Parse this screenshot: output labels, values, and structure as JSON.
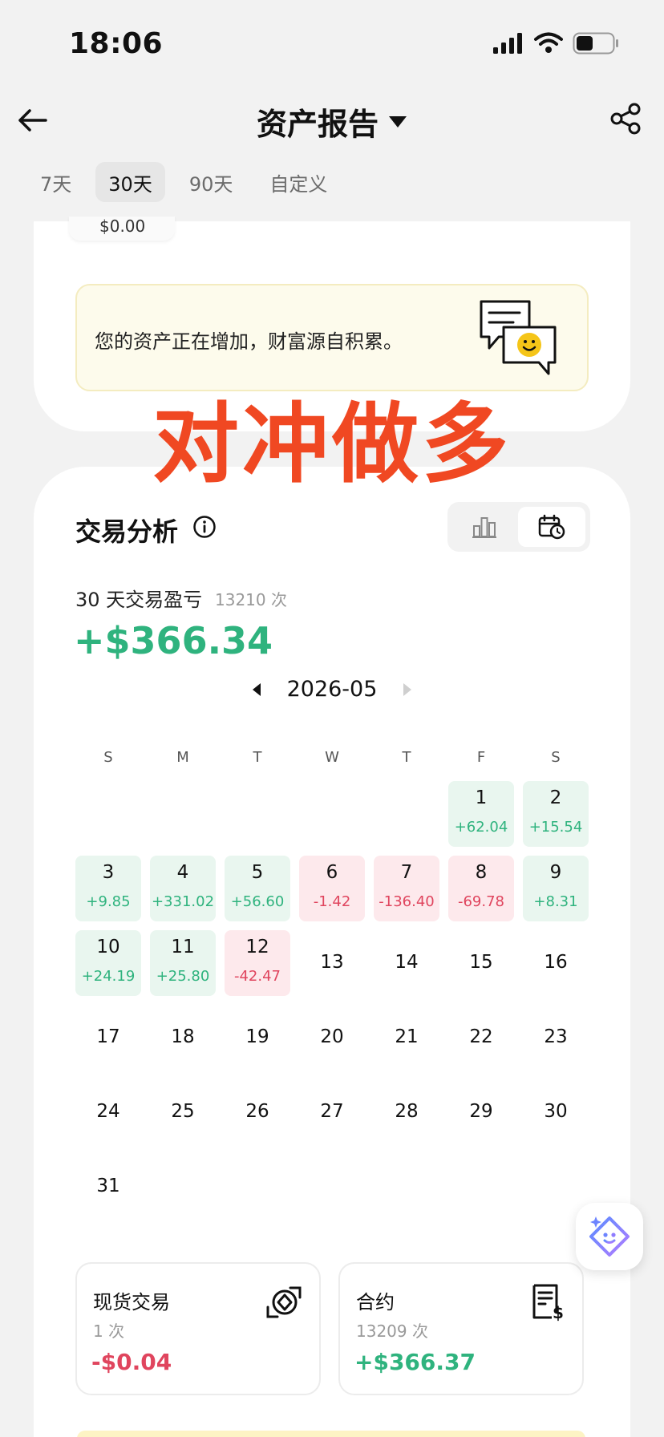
{
  "status_bar": {
    "time": "18:06"
  },
  "header": {
    "title": "资产报告"
  },
  "period_tabs": [
    {
      "label": "7天",
      "active": false
    },
    {
      "label": "30天",
      "active": true
    },
    {
      "label": "90天",
      "active": false
    },
    {
      "label": "自定义",
      "active": false
    }
  ],
  "assets": {
    "prev_value": "$0.00",
    "banner_text": "您的资产正在增加，财富源自积累。"
  },
  "overlay_text": "对冲做多",
  "analysis": {
    "title": "交易分析",
    "pnl_label": "30 天交易盈亏",
    "pnl_count": "13210 次",
    "pnl_value": "+$366.34",
    "month": "2026-05",
    "weekdays": [
      "S",
      "M",
      "T",
      "W",
      "T",
      "F",
      "S"
    ],
    "days": [
      {
        "num": "",
        "pnl": "",
        "tone": ""
      },
      {
        "num": "",
        "pnl": "",
        "tone": ""
      },
      {
        "num": "",
        "pnl": "",
        "tone": ""
      },
      {
        "num": "",
        "pnl": "",
        "tone": ""
      },
      {
        "num": "",
        "pnl": "",
        "tone": ""
      },
      {
        "num": "1",
        "pnl": "+62.04",
        "tone": "pos"
      },
      {
        "num": "2",
        "pnl": "+15.54",
        "tone": "pos"
      },
      {
        "num": "3",
        "pnl": "+9.85",
        "tone": "pos"
      },
      {
        "num": "4",
        "pnl": "+331.02",
        "tone": "pos"
      },
      {
        "num": "5",
        "pnl": "+56.60",
        "tone": "pos"
      },
      {
        "num": "6",
        "pnl": "-1.42",
        "tone": "neg"
      },
      {
        "num": "7",
        "pnl": "-136.40",
        "tone": "neg"
      },
      {
        "num": "8",
        "pnl": "-69.78",
        "tone": "neg"
      },
      {
        "num": "9",
        "pnl": "+8.31",
        "tone": "pos"
      },
      {
        "num": "10",
        "pnl": "+24.19",
        "tone": "pos"
      },
      {
        "num": "11",
        "pnl": "+25.80",
        "tone": "pos"
      },
      {
        "num": "12",
        "pnl": "-42.47",
        "tone": "neg"
      },
      {
        "num": "13",
        "pnl": "",
        "tone": ""
      },
      {
        "num": "14",
        "pnl": "",
        "tone": ""
      },
      {
        "num": "15",
        "pnl": "",
        "tone": ""
      },
      {
        "num": "16",
        "pnl": "",
        "tone": ""
      },
      {
        "num": "17",
        "pnl": "",
        "tone": ""
      },
      {
        "num": "18",
        "pnl": "",
        "tone": ""
      },
      {
        "num": "19",
        "pnl": "",
        "tone": ""
      },
      {
        "num": "20",
        "pnl": "",
        "tone": ""
      },
      {
        "num": "21",
        "pnl": "",
        "tone": ""
      },
      {
        "num": "22",
        "pnl": "",
        "tone": ""
      },
      {
        "num": "23",
        "pnl": "",
        "tone": ""
      },
      {
        "num": "24",
        "pnl": "",
        "tone": ""
      },
      {
        "num": "25",
        "pnl": "",
        "tone": ""
      },
      {
        "num": "26",
        "pnl": "",
        "tone": ""
      },
      {
        "num": "27",
        "pnl": "",
        "tone": ""
      },
      {
        "num": "28",
        "pnl": "",
        "tone": ""
      },
      {
        "num": "29",
        "pnl": "",
        "tone": ""
      },
      {
        "num": "30",
        "pnl": "",
        "tone": ""
      },
      {
        "num": "31",
        "pnl": "",
        "tone": ""
      }
    ]
  },
  "summary": {
    "spot": {
      "title": "现货交易",
      "count": "1 次",
      "value": "-$0.04"
    },
    "futures": {
      "title": "合约",
      "count": "13209 次",
      "value": "+$366.37"
    }
  },
  "colors": {
    "positive": "#2fb37e",
    "negative": "#e0455e",
    "overlay": "#f04822",
    "banner_bg": "#fdfbec"
  },
  "icons": {
    "back": "arrow-left-icon",
    "title_dropdown": "caret-down-icon",
    "share": "share-icon",
    "info": "info-icon",
    "bar_view": "bar-chart-icon",
    "calendar_view": "calendar-clock-icon",
    "spot": "coin-swap-icon",
    "futures": "dollar-document-icon",
    "assistant": "ai-assistant-icon"
  }
}
